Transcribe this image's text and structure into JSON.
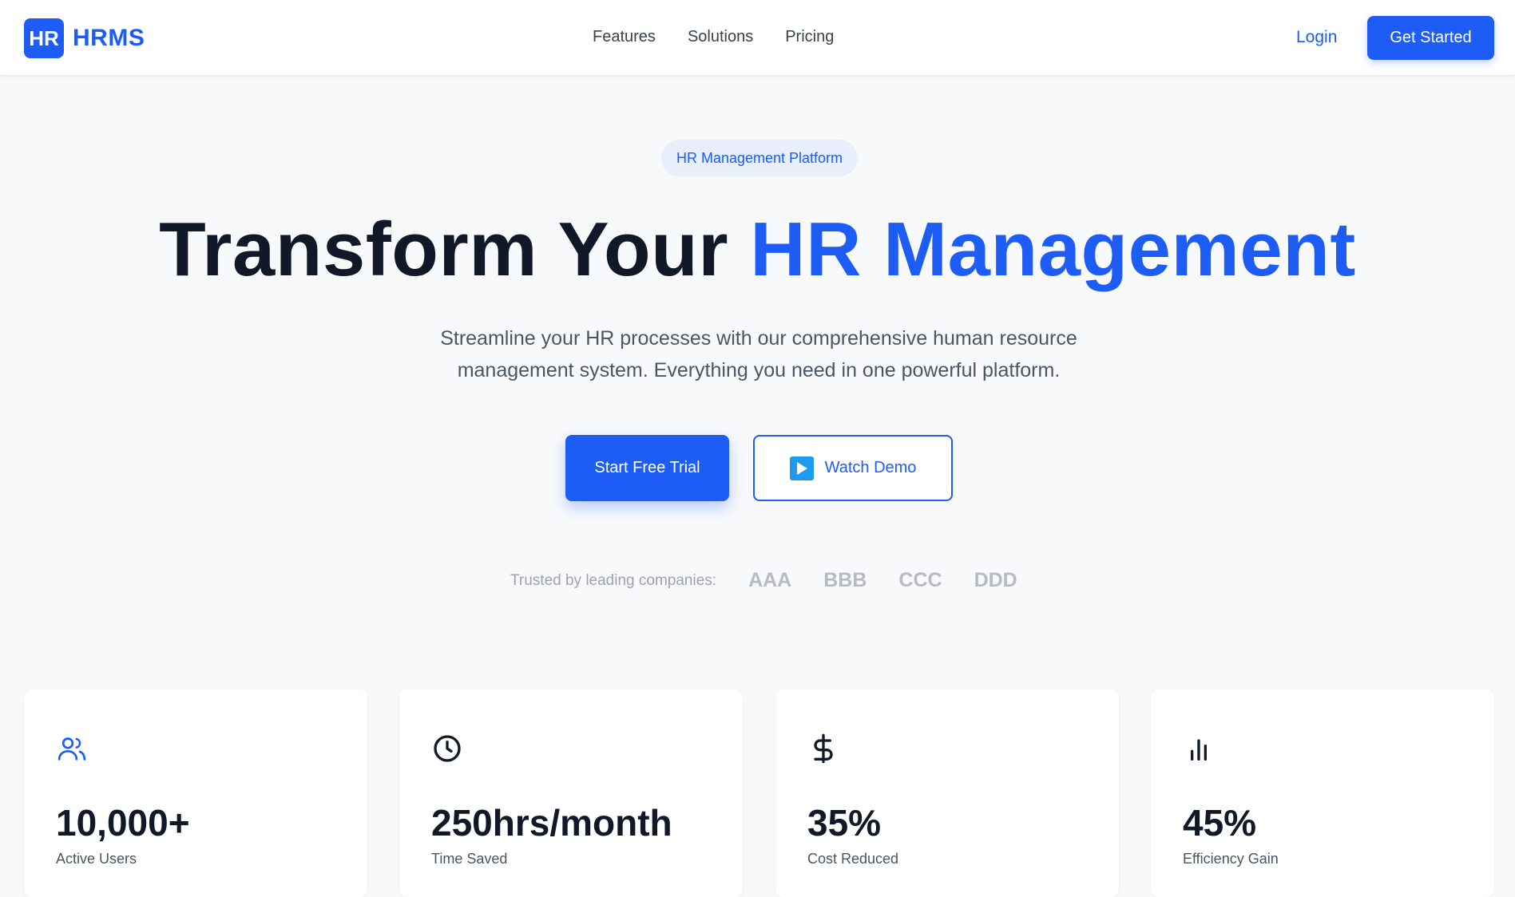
{
  "nav": {
    "logo_mark": "HR",
    "logo_text": "HRMS",
    "links": [
      "Features",
      "Solutions",
      "Pricing"
    ],
    "login": "Login",
    "cta": "Get Started"
  },
  "hero": {
    "badge": "HR Management Platform",
    "headline_main": "Transform Your ",
    "headline_accent": "HR Management",
    "subtitle": "Streamline your HR processes with our comprehensive human resource management system. Everything you need in one powerful platform.",
    "primary_button": "Start Free Trial",
    "secondary_button": "Watch Demo",
    "trusted_label": "Trusted by leading companies:",
    "companies": [
      "AAA",
      "BBB",
      "CCC",
      "DDD"
    ]
  },
  "stats": [
    {
      "icon": "users-icon",
      "value": "10,000+",
      "label": "Active Users"
    },
    {
      "icon": "clock-icon",
      "value": "250hrs/month",
      "label": "Time Saved"
    },
    {
      "icon": "dollar-icon",
      "value": "35%",
      "label": "Cost Reduced"
    },
    {
      "icon": "bar-chart-icon",
      "value": "45%",
      "label": "Efficiency Gain"
    }
  ],
  "colors": {
    "accent": "#1d5cf5",
    "play": "#1d9bf0"
  }
}
